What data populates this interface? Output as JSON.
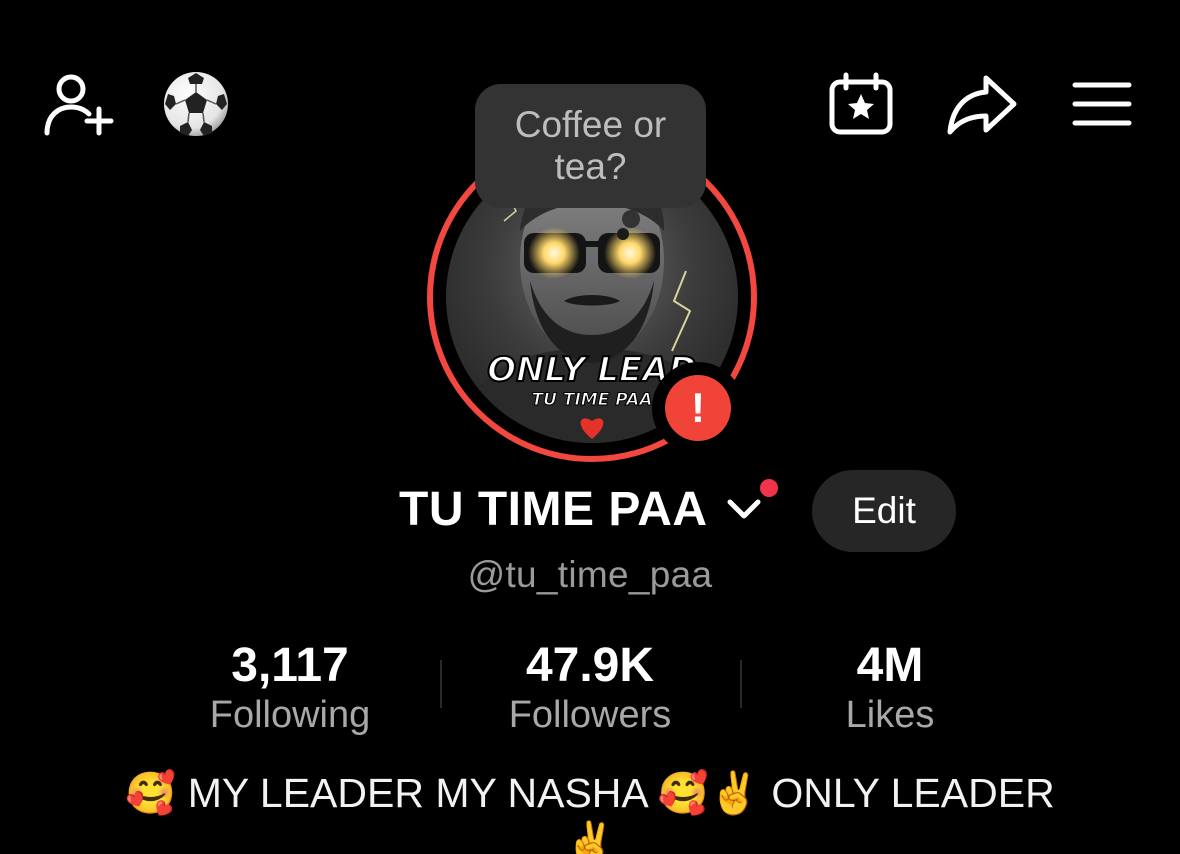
{
  "header": {
    "add_friend_icon": "person-add-icon",
    "sports_icon": "soccer-ball-icon",
    "calendar_icon": "calendar-star-icon",
    "share_icon": "share-arrow-icon",
    "menu_icon": "hamburger-menu-icon"
  },
  "note": {
    "text": "Coffee or tea?"
  },
  "avatar": {
    "overlay_text_1": "ONLY LEAD",
    "overlay_text_2": "TU TIME PAA",
    "ring_color": "#f2483f"
  },
  "badge": {
    "symbol": "!",
    "color": "#f04438"
  },
  "profile": {
    "display_name": "TU TIME PAA",
    "username": "@tu_time_paa",
    "edit_label": "Edit"
  },
  "stats": [
    {
      "value": "3,117",
      "label": "Following"
    },
    {
      "value": "47.9K",
      "label": "Followers"
    },
    {
      "value": "4M",
      "label": "Likes"
    }
  ],
  "bio": {
    "part1": "🥰 MY LEADER MY NASHA 🥰✌️ ONLY LEADER",
    "part2": "✌️"
  }
}
